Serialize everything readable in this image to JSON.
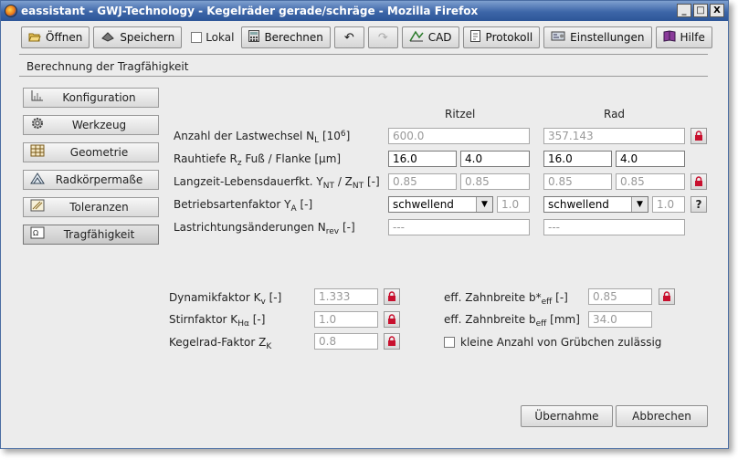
{
  "window": {
    "title": "eassistant - GWJ-Technology - Kegelräder gerade/schräge - Mozilla Firefox",
    "controls": {
      "minimize": "_",
      "maximize": "□",
      "close": "X"
    }
  },
  "toolbar": {
    "open": "Öffnen",
    "save": "Speichern",
    "local": "Lokal",
    "calculate": "Berechnen",
    "undo": "↶",
    "redo": "↷",
    "cad": "CAD",
    "protocol": "Protokoll",
    "settings": "Einstellungen",
    "help": "Hilfe"
  },
  "section_title": "Berechnung der Tragfähigkeit",
  "nav": [
    {
      "label": "Konfiguration",
      "icon": "ruler-icon"
    },
    {
      "label": "Werkzeug",
      "icon": "gear-icon"
    },
    {
      "label": "Geometrie",
      "icon": "grid-icon"
    },
    {
      "label": "Radkörpermaße",
      "icon": "drawing-icon"
    },
    {
      "label": "Toleranzen",
      "icon": "tolerance-icon"
    },
    {
      "label": "Tragfähigkeit",
      "icon": "formula-icon"
    }
  ],
  "columns": {
    "ritzel": "Ritzel",
    "rad": "Rad"
  },
  "rows": {
    "lastwechsel": {
      "pre": "Anzahl der Lastwechsel N",
      "sub": "L",
      "mid": " [10",
      "sup": "6",
      "post": "]",
      "ritzel": "600.0",
      "rad": "357.143"
    },
    "rauhtiefe": {
      "pre": "Rauhtiefe R",
      "sub": "z",
      "post": " Fuß / Flanke [µm]",
      "ritzel_fuss": "16.0",
      "ritzel_flanke": "4.0",
      "rad_fuss": "16.0",
      "rad_flanke": "4.0"
    },
    "lebensdauer": {
      "pre": "Langzeit-Lebensdauerfkt. Y",
      "sub1": "NT",
      "mid": " / Z",
      "sub2": "NT",
      "post": " [-]",
      "ritzel_y": "0.85",
      "ritzel_z": "0.85",
      "rad_y": "0.85",
      "rad_z": "0.85"
    },
    "betriebsart": {
      "pre": "Betriebsartenfaktor Y",
      "sub": "A",
      "post": " [-]",
      "ritzel_select": "schwellend",
      "ritzel_value": "1.0",
      "rad_select": "schwellend",
      "rad_value": "1.0",
      "help": "?"
    },
    "lastrichtung": {
      "pre": "Lastrichtungsänderungen N",
      "sub": "rev",
      "post": " [-]",
      "ritzel": "---",
      "rad": "---"
    }
  },
  "factors": {
    "dynamik": {
      "pre": "Dynamikfaktor K",
      "sub": "v",
      "post": " [-]",
      "value": "1.333"
    },
    "stirn": {
      "pre": "Stirnfaktor K",
      "sub": "Hα",
      "post": " [-]",
      "value": "1.0"
    },
    "kegelrad": {
      "pre": "Kegelrad-Faktor Z",
      "sub": "K",
      "post": "",
      "value": "0.8"
    },
    "zahnbreite_rel": {
      "pre": "eff. Zahnbreite b*",
      "sub": "eff",
      "post": " [-]",
      "value": "0.85"
    },
    "zahnbreite_abs": {
      "pre": "eff. Zahnbreite b",
      "sub": "eff",
      "post": " [mm]",
      "value": "34.0"
    },
    "gruebchen": "kleine Anzahl von Grübchen zulässig"
  },
  "buttons": {
    "apply": "Übernahme",
    "cancel": "Abbrechen"
  },
  "colors": {
    "title_bar": "#3d66a8",
    "lock_red": "#c8102e"
  }
}
